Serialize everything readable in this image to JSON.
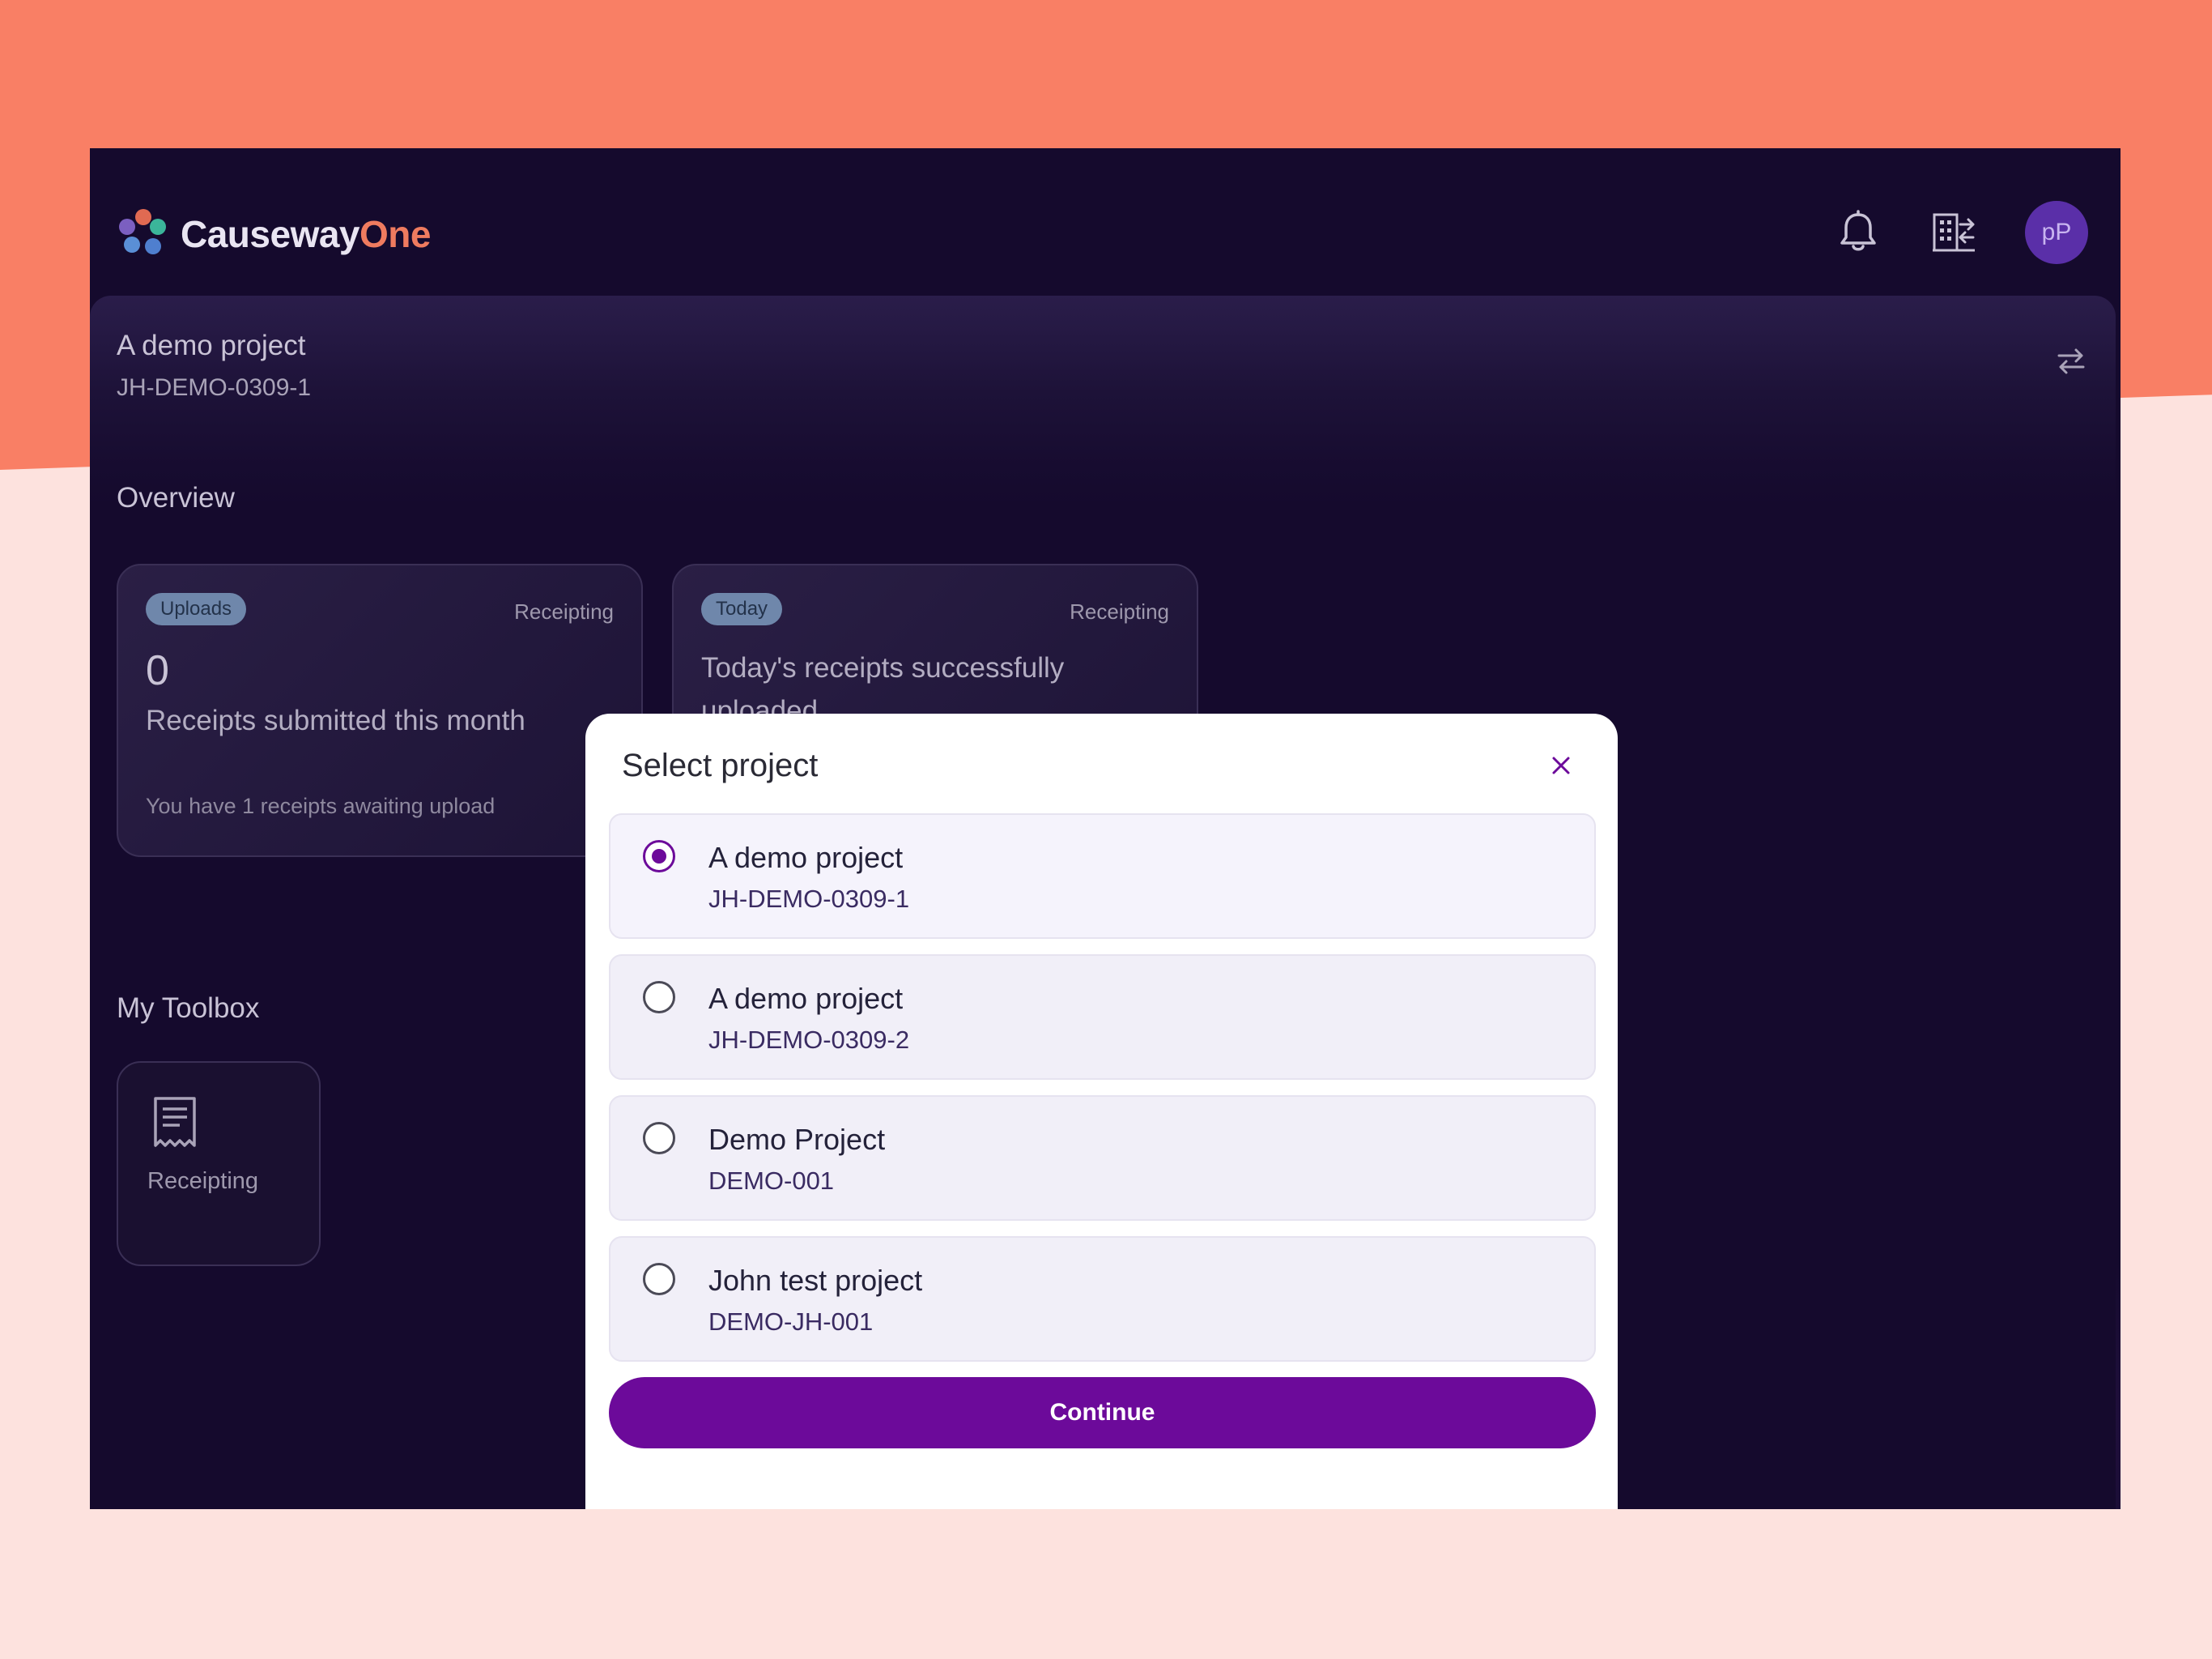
{
  "app": {
    "logo_word1": "Causeway",
    "logo_word2": "One",
    "avatar_initials": "pP"
  },
  "current_project": {
    "name": "A demo project",
    "code": "JH-DEMO-0309-1"
  },
  "overview": {
    "title": "Overview",
    "cards": [
      {
        "badge": "Uploads",
        "category": "Receipting",
        "number": "0",
        "label": "Receipts submitted this month",
        "footer": "You have 1 receipts awaiting upload"
      },
      {
        "badge": "Today",
        "category": "Receipting",
        "text": "Today's receipts successfully uploaded."
      }
    ]
  },
  "toolbox": {
    "title": "My Toolbox",
    "items": [
      {
        "label": "Receipting",
        "icon": "receipt-icon"
      }
    ]
  },
  "modal": {
    "title": "Select project",
    "options": [
      {
        "name": "A demo project",
        "code": "JH-DEMO-0309-1",
        "selected": true
      },
      {
        "name": "A demo project",
        "code": "JH-DEMO-0309-2",
        "selected": false
      },
      {
        "name": "Demo Project",
        "code": "DEMO-001",
        "selected": false
      },
      {
        "name": "John test project",
        "code": "DEMO-JH-001",
        "selected": false
      }
    ],
    "continue_label": "Continue"
  },
  "colors": {
    "app_bg": "#150a2d",
    "accent_purple": "#6c0a9a",
    "brand_orange": "#ef7b5f",
    "backdrop_top": "#f97f65",
    "backdrop_bottom": "#fde2de"
  }
}
